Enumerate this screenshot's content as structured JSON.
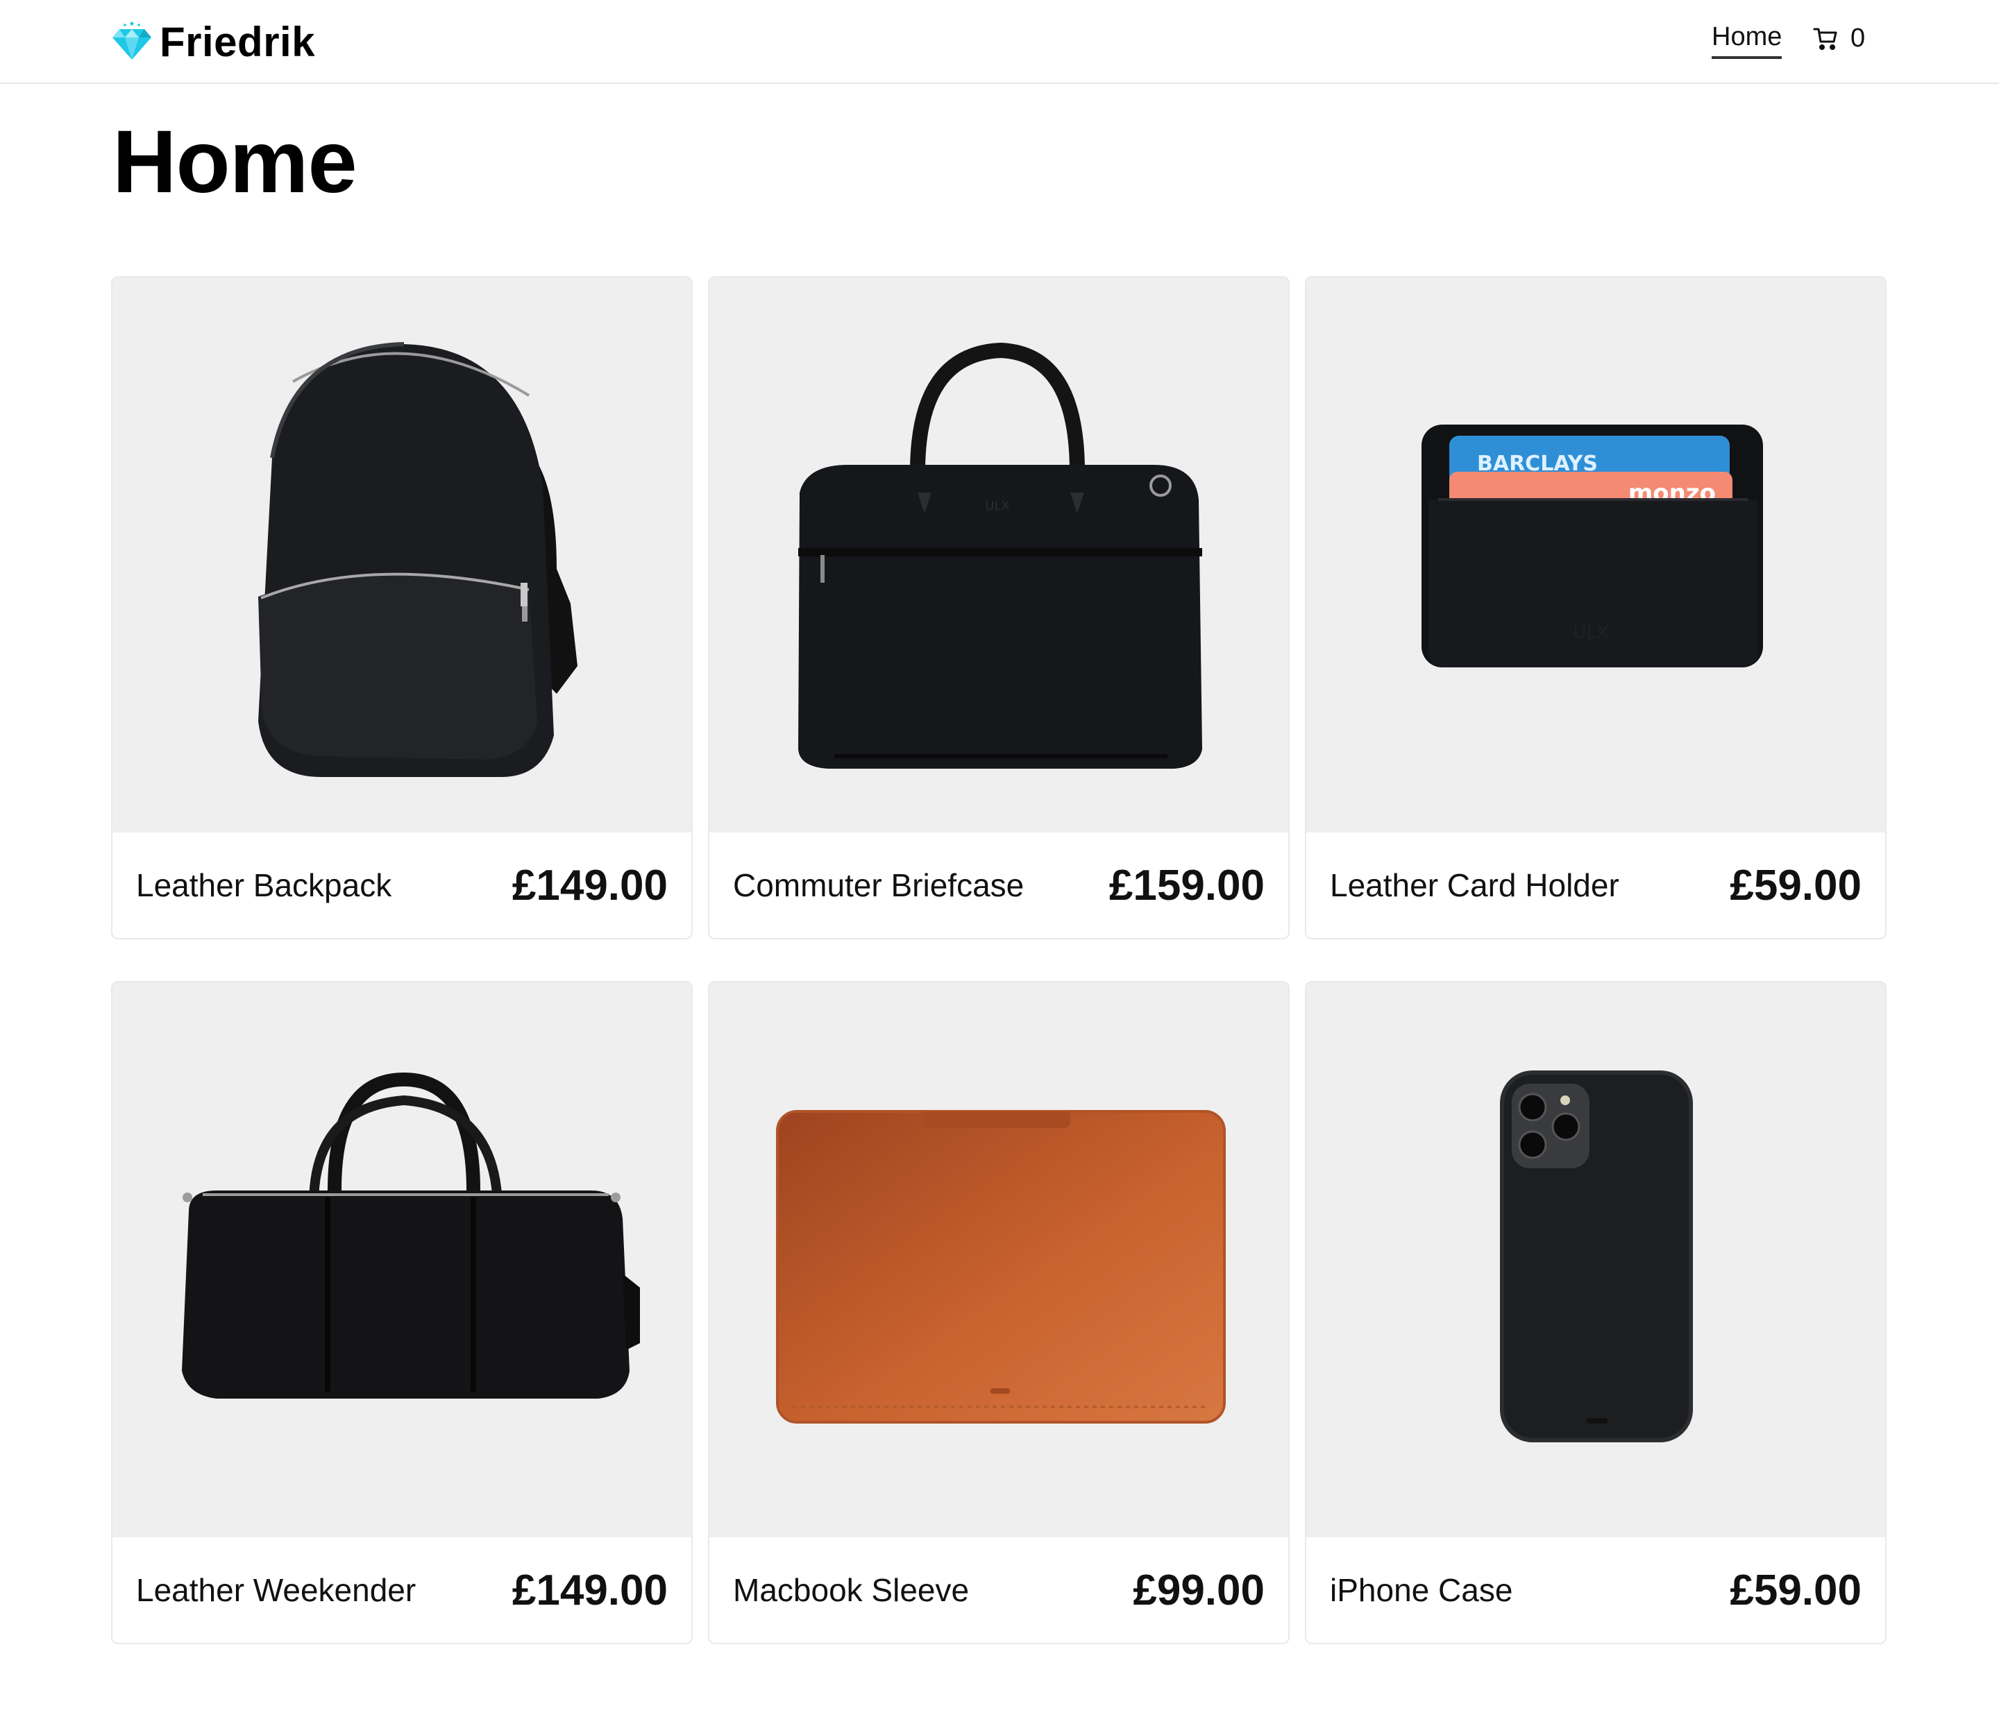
{
  "header": {
    "brand": "Friedrik",
    "nav_home": "Home",
    "cart_count": "0"
  },
  "page": {
    "title": "Home"
  },
  "products": [
    {
      "name": "Leather Backpack",
      "price": "£149.00"
    },
    {
      "name": "Commuter Briefcase",
      "price": "£159.00"
    },
    {
      "name": "Leather Card Holder",
      "price": "£59.00"
    },
    {
      "name": "Leather Weekender",
      "price": "£149.00"
    },
    {
      "name": "Macbook Sleeve",
      "price": "£99.00"
    },
    {
      "name": "iPhone Case",
      "price": "£59.00"
    }
  ],
  "card_holder_cards": {
    "top": "BARCLAYS",
    "bottom": "monzo"
  },
  "colors": {
    "brand_diamond": "#1ec8e6",
    "image_bg": "#efefef",
    "sleeve": "#c8622e"
  }
}
